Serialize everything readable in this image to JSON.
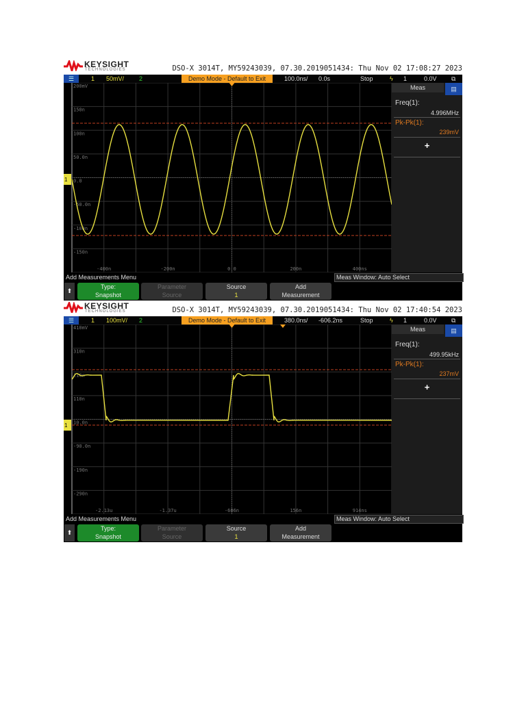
{
  "scopes": [
    {
      "logo": "KEYSIGHT",
      "logo_sub": "TECHNOLOGIES",
      "title": "DSO-X 3014T, MY59243039, 07.30.2019051434: Thu Nov 02 17:08:27 2023",
      "status": {
        "ch1": "1",
        "scale": "50mV/",
        "ch2": "2",
        "demo": "Demo Mode - Default to Exit",
        "timebase": "100.0ns/",
        "delay": "0.0s",
        "run": "Stop",
        "trig_src": "1",
        "trig_level": "0.0V"
      },
      "y_labels": [
        "200mV",
        "150n",
        "100n",
        "50.0n",
        "0.0",
        "-50.0n",
        "-100n",
        "-150n"
      ],
      "x_labels": [
        "-400n",
        "-200n",
        "0.0",
        "200n",
        "400ns"
      ],
      "meas": {
        "header": "Meas",
        "m1_label": "Freq(1):",
        "m1_value": "4.996MHz",
        "m2_label": "Pk-Pk(1):",
        "m2_value": "239mV",
        "add": "+"
      },
      "menu": {
        "title": "Add Measurements Menu",
        "meas_window": "Meas Window: Auto Select",
        "type_label": "Type:",
        "type_value": "Snapshot",
        "param_label": "Parameter",
        "param_value": "Source",
        "source_label": "Source",
        "source_value": "1",
        "add_label": "Add",
        "add_value": "Measurement"
      },
      "waveform": "sine"
    },
    {
      "logo": "KEYSIGHT",
      "logo_sub": "TECHNOLOGIES",
      "title": "DSO-X 3014T, MY59243039, 07.30.2019051434: Thu Nov 02 17:40:54 2023",
      "status": {
        "ch1": "1",
        "scale": "100mV/",
        "ch2": "2",
        "demo": "Demo Mode - Default to Exit",
        "timebase": "380.0ns/",
        "delay": "-606.2ns",
        "run": "Stop",
        "trig_src": "1",
        "trig_level": "0.0V"
      },
      "y_labels": [
        "410mV",
        "310n",
        "210n",
        "110n",
        "10.0n",
        "-90.0n",
        "-190n",
        "-290n"
      ],
      "x_labels": [
        "-2.13u",
        "-1.37u",
        "-606n",
        "156n",
        "914ns"
      ],
      "meas": {
        "header": "Meas",
        "m1_label": "Freq(1):",
        "m1_value": "499.95kHz",
        "m2_label": "Pk-Pk(1):",
        "m2_value": "237mV",
        "add": "+"
      },
      "menu": {
        "title": "Add Measurements Menu",
        "meas_window": "Meas Window: Auto Select",
        "type_label": "Type:",
        "type_value": "Snapshot",
        "param_label": "Parameter",
        "param_value": "Source",
        "source_label": "Source",
        "source_value": "1",
        "add_label": "Add",
        "add_value": "Measurement"
      },
      "waveform": "square"
    }
  ],
  "colors": {
    "trace": "#e8e040",
    "cursor": "#c04020",
    "accent": "#f7a020"
  }
}
